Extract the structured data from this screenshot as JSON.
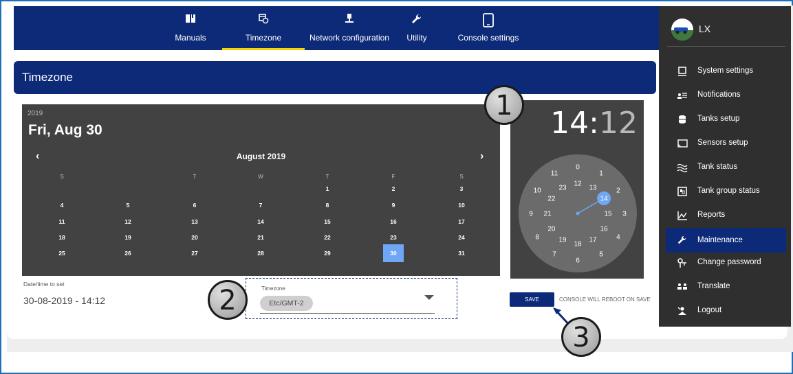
{
  "topnav": {
    "items": [
      {
        "label": "Manuals",
        "icon": "book-icon"
      },
      {
        "label": "Timezone",
        "icon": "calendar-clock-icon",
        "active": true
      },
      {
        "label": "Network configuration",
        "icon": "network-icon"
      },
      {
        "label": "Utility",
        "icon": "wrench-icon"
      },
      {
        "label": "Console settings",
        "icon": "tablet-icon"
      }
    ]
  },
  "sidebar": {
    "user": "LX",
    "items": [
      {
        "label": "System settings",
        "icon": "monitor-icon"
      },
      {
        "label": "Notifications",
        "icon": "notifications-icon"
      },
      {
        "label": "Tanks setup",
        "icon": "database-icon"
      },
      {
        "label": "Sensors setup",
        "icon": "cast-icon"
      },
      {
        "label": "Tank status",
        "icon": "waves-icon"
      },
      {
        "label": "Tank group status",
        "icon": "group-box-icon"
      },
      {
        "label": "Reports",
        "icon": "chart-icon"
      },
      {
        "label": "Maintenance",
        "icon": "wrench-icon",
        "active": true
      },
      {
        "label": "Change password",
        "icon": "key-icon"
      },
      {
        "label": "Translate",
        "icon": "translate-icon"
      },
      {
        "label": "Logout",
        "icon": "logout-icon"
      }
    ]
  },
  "header": {
    "title": "Timezone"
  },
  "calendar": {
    "year": "2019",
    "date": "Fri, Aug 30",
    "month": "August 2019",
    "prev": "‹",
    "next": "›",
    "weekdays": [
      "S",
      "",
      "T",
      "W",
      "T",
      "F",
      "S"
    ],
    "weeks": [
      [
        "",
        "",
        "",
        "",
        "1",
        "2",
        "3"
      ],
      [
        "4",
        "5",
        "6",
        "7",
        "8",
        "9",
        "10"
      ],
      [
        "11",
        "12",
        "13",
        "14",
        "15",
        "16",
        "17"
      ],
      [
        "18",
        "19",
        "20",
        "21",
        "22",
        "23",
        "24"
      ],
      [
        "25",
        "26",
        "27",
        "28",
        "29",
        "30",
        "31"
      ]
    ],
    "selected": "30"
  },
  "clock": {
    "hours": "14",
    "sep": ":",
    "minutes": "12",
    "selected_hour": "14",
    "outer_numbers": [
      "0",
      "1",
      "2",
      "3",
      "4",
      "5",
      "6",
      "7",
      "8",
      "9",
      "10",
      "11"
    ],
    "inner_numbers": [
      "12",
      "13",
      "14",
      "15",
      "16",
      "17",
      "18",
      "19",
      "20",
      "21",
      "22",
      "23"
    ]
  },
  "datetime": {
    "label": "Date/time to set",
    "value": "30-08-2019 - 14:12"
  },
  "timezone": {
    "label": "Timezone",
    "value": "Etc/GMT-2"
  },
  "actions": {
    "save": "SAVE",
    "note": "CONSOLE WILL REBOOT ON SAVE"
  },
  "callouts": [
    "1",
    "2",
    "3"
  ],
  "colors": {
    "nav": "#0d2a78",
    "panel": "#424242",
    "selected": "#6fa6f5",
    "accent": "#f5d400",
    "sidebar": "#2f2f2f"
  }
}
